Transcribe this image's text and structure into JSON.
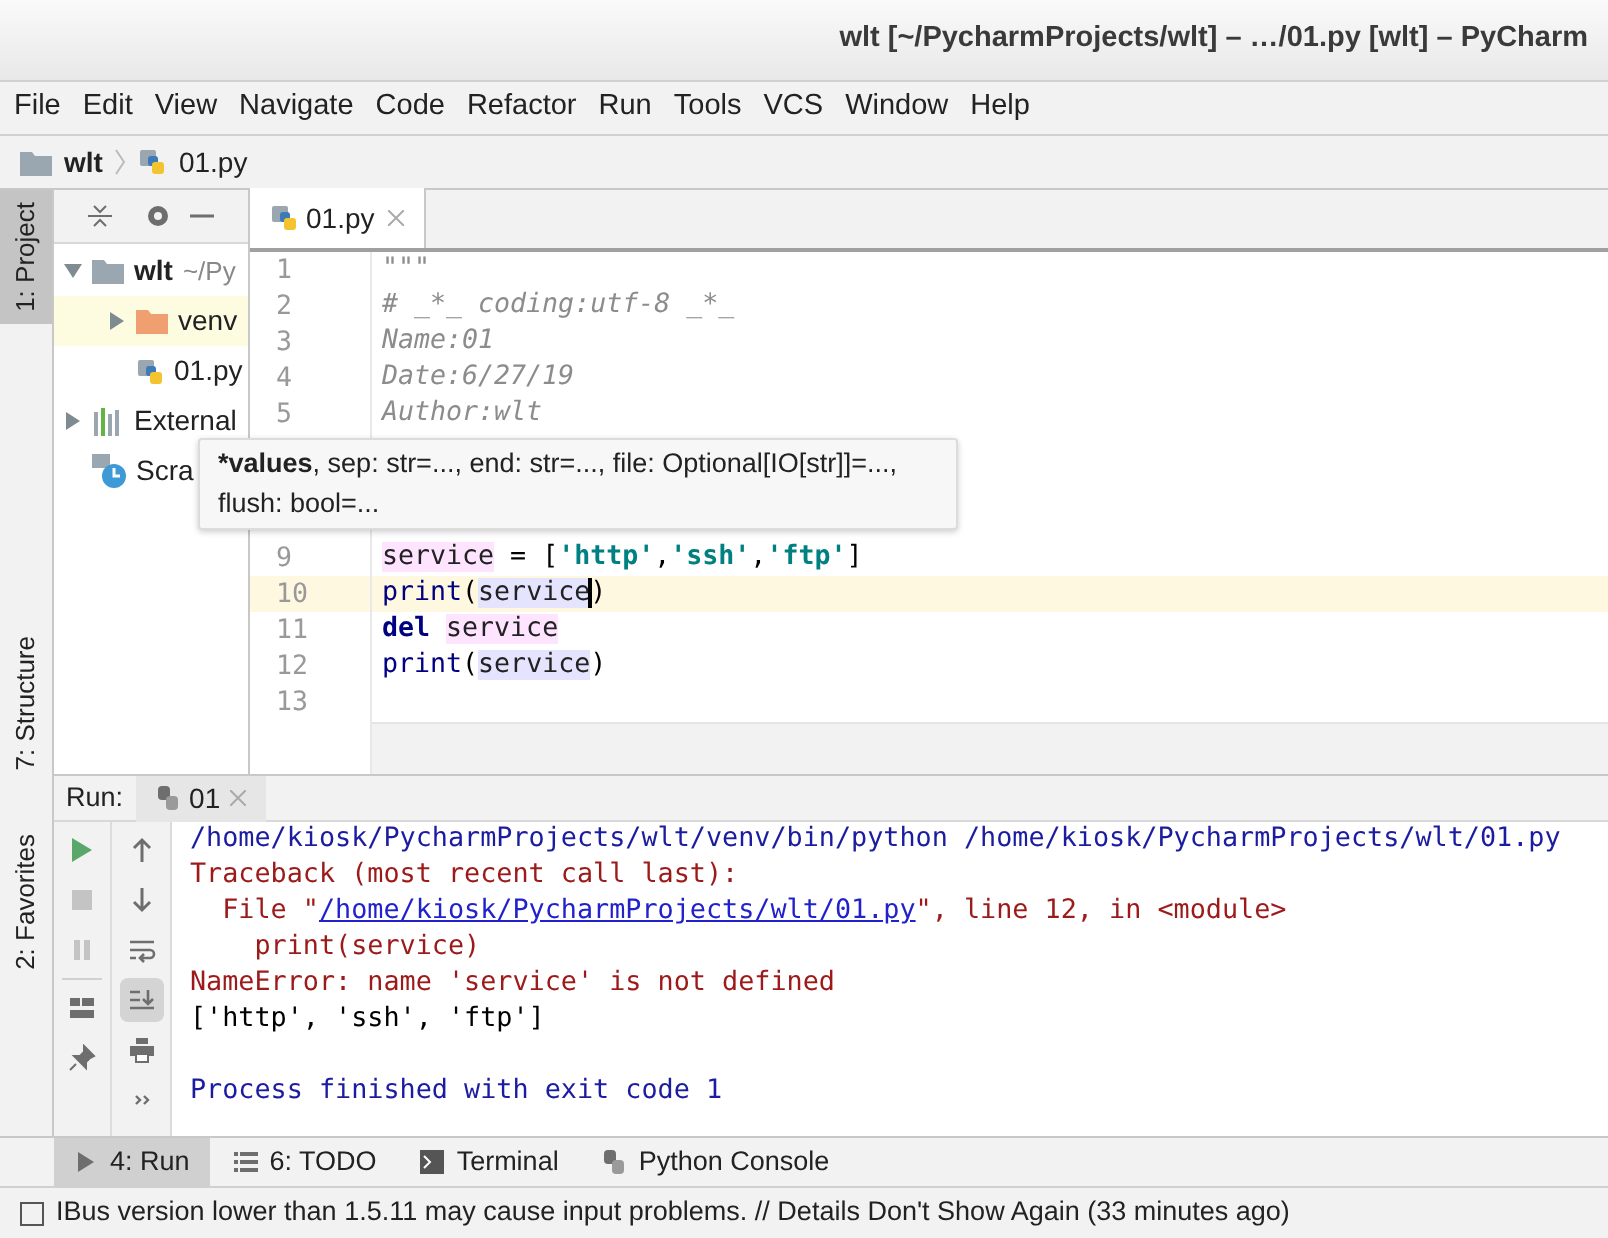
{
  "window": {
    "title": "wlt [~/PycharmProjects/wlt] – …/01.py [wlt] – PyCharm"
  },
  "menu": [
    "File",
    "Edit",
    "View",
    "Navigate",
    "Code",
    "Refactor",
    "Run",
    "Tools",
    "VCS",
    "Window",
    "Help"
  ],
  "breadcrumb": {
    "project": "wlt",
    "file": "01.py"
  },
  "tool_stripe": [
    {
      "label": "1: Project",
      "selected": true
    },
    {
      "label": "7: Structure",
      "selected": false
    },
    {
      "label": "2: Favorites",
      "selected": false
    }
  ],
  "project_tree": [
    {
      "label": "wlt",
      "hint": "~/Py",
      "kind": "folder",
      "expanded": true,
      "selected": false,
      "children": [
        {
          "label": "venv",
          "kind": "venv",
          "expanded": false,
          "selected": true
        },
        {
          "label": "01.py",
          "kind": "python",
          "selected": false
        }
      ]
    },
    {
      "label": "External",
      "kind": "library",
      "expanded": false,
      "selected": false
    },
    {
      "label": "Scra",
      "kind": "scratch",
      "selected": false
    }
  ],
  "editor_tab": {
    "label": "01.py",
    "selected": true
  },
  "code_lines": [
    {
      "number": "1",
      "current": false,
      "tokens": [
        {
          "text": "\"\"\"",
          "kind": "docstring"
        }
      ]
    },
    {
      "number": "2",
      "current": false,
      "tokens": [
        {
          "text": "# _*_ coding:utf-8 _*_",
          "kind": "docstring"
        }
      ]
    },
    {
      "number": "3",
      "current": false,
      "tokens": [
        {
          "text": "Name:01",
          "kind": "docstring"
        }
      ]
    },
    {
      "number": "4",
      "current": false,
      "tokens": [
        {
          "text": "Date:6/27/19",
          "kind": "docstring"
        }
      ]
    },
    {
      "number": "5",
      "current": false,
      "tokens": [
        {
          "text": "Author:wlt",
          "kind": "docstring"
        }
      ]
    },
    {
      "number": "9",
      "current": false,
      "tokens": [
        {
          "text": "service",
          "kind": "write"
        },
        {
          "text": " = [",
          "kind": "plain"
        },
        {
          "text": "'http'",
          "kind": "string"
        },
        {
          "text": ",",
          "kind": "plain"
        },
        {
          "text": "'ssh'",
          "kind": "string"
        },
        {
          "text": ",",
          "kind": "plain"
        },
        {
          "text": "'ftp'",
          "kind": "string"
        },
        {
          "text": "]",
          "kind": "plain"
        }
      ]
    },
    {
      "number": "10",
      "current": true,
      "tokens": [
        {
          "text": "print",
          "kind": "builtin"
        },
        {
          "text": "(",
          "kind": "plain"
        },
        {
          "text": "service",
          "kind": "read"
        },
        {
          "text": ")",
          "kind": "plain"
        }
      ]
    },
    {
      "number": "11",
      "current": false,
      "tokens": [
        {
          "text": "del ",
          "kind": "keyword"
        },
        {
          "text": "service",
          "kind": "write"
        }
      ]
    },
    {
      "number": "12",
      "current": false,
      "tokens": [
        {
          "text": "print",
          "kind": "builtin"
        },
        {
          "text": "(",
          "kind": "plain"
        },
        {
          "text": "service",
          "kind": "read"
        },
        {
          "text": ")",
          "kind": "plain"
        }
      ]
    },
    {
      "number": "13",
      "current": false
    }
  ],
  "tooltip": {
    "current_param": "*values",
    "rest": ", sep: str=..., end: str=..., file: Optional[IO[str]]=..., flush: bool=..."
  },
  "run_panel": {
    "label": "Run:",
    "tab": "01",
    "left_tools": [
      {
        "kind": "run",
        "disabled": false
      },
      {
        "kind": "stop",
        "disabled": true
      },
      {
        "kind": "pause",
        "disabled": true
      },
      {
        "kind": "layout",
        "disabled": false
      },
      {
        "kind": "pin",
        "disabled": false
      }
    ],
    "right_tools": [
      {
        "kind": "up",
        "selected": false
      },
      {
        "kind": "down",
        "selected": false
      },
      {
        "kind": "wrap",
        "selected": false
      },
      {
        "kind": "scroll_end",
        "selected": true
      },
      {
        "kind": "print",
        "selected": false
      },
      {
        "kind": "more",
        "selected": false
      }
    ],
    "output": [
      {
        "blank_before": false,
        "segments": [
          {
            "text": "/home/kiosk/PycharmProjects/wlt/venv/bin/python /home/kiosk/PycharmProjects/wlt/01.py",
            "kind": "system"
          }
        ]
      },
      {
        "blank_before": false,
        "segments": [
          {
            "text": "Traceback (most recent call last):",
            "kind": "error"
          }
        ]
      },
      {
        "blank_before": false,
        "segments": [
          {
            "text": "  File \"",
            "kind": "error"
          },
          {
            "text": "/home/kiosk/PycharmProjects/wlt/01.py",
            "kind": "link"
          },
          {
            "text": "\", line 12, in <module>",
            "kind": "error"
          }
        ]
      },
      {
        "blank_before": false,
        "segments": [
          {
            "text": "    print(service)",
            "kind": "error"
          }
        ]
      },
      {
        "blank_before": false,
        "segments": [
          {
            "text": "NameError: name 'service' is not defined",
            "kind": "error"
          }
        ]
      },
      {
        "blank_before": false,
        "segments": [
          {
            "text": "['http', 'ssh', 'ftp']",
            "kind": "normal"
          }
        ]
      },
      {
        "blank_before": true,
        "segments": [
          {
            "text": "Process finished with exit code 1",
            "kind": "system"
          }
        ]
      }
    ]
  },
  "bottom_tabs": [
    {
      "label": "4: Run",
      "kind": "run",
      "selected": true
    },
    {
      "label": "6: TODO",
      "kind": "todo",
      "selected": false
    },
    {
      "label": "Terminal",
      "kind": "terminal",
      "selected": false
    },
    {
      "label": "Python Console",
      "kind": "console",
      "selected": false
    }
  ],
  "status_bar": {
    "message": "IBus version lower than 1.5.11 may cause input problems. // Details Don't Show Again (33 minutes ago)"
  }
}
